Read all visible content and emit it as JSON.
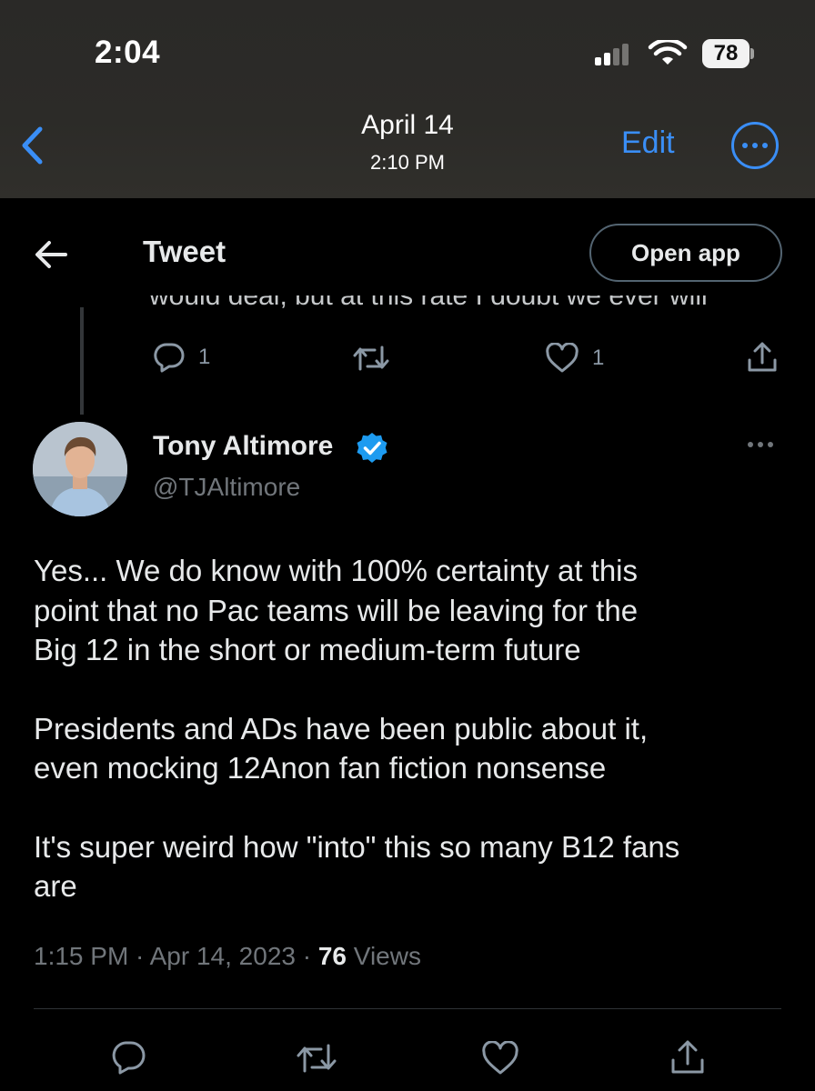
{
  "status_bar": {
    "time": "2:04",
    "battery": "78"
  },
  "photo_nav": {
    "date": "April 14",
    "time": "2:10 PM",
    "edit_label": "Edit"
  },
  "tweet_header": {
    "title": "Tweet",
    "open_app_label": "Open app"
  },
  "previous_tweet": {
    "cut_text": "would deal, but at this rate I doubt we ever will",
    "reply_count": "1",
    "like_count": "1"
  },
  "tweet": {
    "author_name": "Tony Altimore",
    "author_handle": "@TJAltimore",
    "paragraphs": [
      [
        "Yes... We do know with 100% certainty at this",
        "point that no Pac teams will be leaving for the",
        "Big 12 in the short or medium-term future"
      ],
      [
        "Presidents and ADs have been public about it,",
        "even mocking 12Anon fan fiction nonsense"
      ],
      [
        "It's super weird how \"into\" this so many B12 fans",
        "are"
      ]
    ],
    "timestamp": "1:15 PM · Apr 14, 2023 · ",
    "views_count": "76",
    "views_label": " Views"
  },
  "colors": {
    "accent": "#3a8ef6",
    "verified": "#1d9bf0",
    "muted": "#71767b"
  },
  "icons": [
    "chevron-left-icon",
    "arrow-left-icon",
    "reply-icon",
    "retweet-icon",
    "like-icon",
    "share-icon",
    "verified-badge-icon",
    "more-icon"
  ]
}
